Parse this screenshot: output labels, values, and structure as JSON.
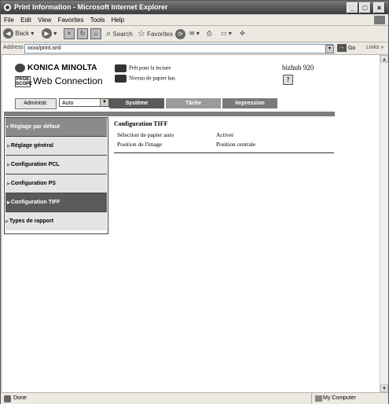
{
  "window": {
    "title": "Print Information - Microsoft Internet Explorer"
  },
  "menu": [
    "File",
    "Edit",
    "View",
    "Favorites",
    "Tools",
    "Help"
  ],
  "toolbar": {
    "back": "Back",
    "search": "Search",
    "favorites": "Favorites"
  },
  "address": {
    "label": "Address",
    "value": "xxxx/print.xml",
    "go": "Go",
    "links": "Links"
  },
  "page": {
    "brand": "KONICA MINOLTA",
    "product": "Web Connection",
    "product_badge": "PAGE SCOPE",
    "status_ready": "Prêt pour la lecture",
    "status_paper": "Niveau de papier bas",
    "model": "bizhub 920",
    "admin_button": "Administr.",
    "mode_select": "Auto",
    "tabs": [
      "Système",
      "Tâche",
      "Impression"
    ],
    "sidebar": [
      {
        "label": "Réglage par défaut",
        "type": "header"
      },
      {
        "label": "Réglage général",
        "type": "item"
      },
      {
        "label": "Configuration PCL",
        "type": "item"
      },
      {
        "label": "Configuration PS",
        "type": "item"
      },
      {
        "label": "Configuration TIFF",
        "type": "selected"
      },
      {
        "label": "Types de rapport",
        "type": "item"
      }
    ],
    "section_title": "Configuration TIFF",
    "rows": [
      {
        "label": "Sélection de papier auto",
        "value": "Activer"
      },
      {
        "label": "Position de l'image",
        "value": "Position centrale"
      }
    ]
  },
  "status": {
    "text": "Done",
    "zone": "My Computer"
  },
  "colors": {
    "tab_active": "#5a5a5a",
    "tab_inactive": "#9a9a9a",
    "tab_third": "#7a7a7a"
  }
}
